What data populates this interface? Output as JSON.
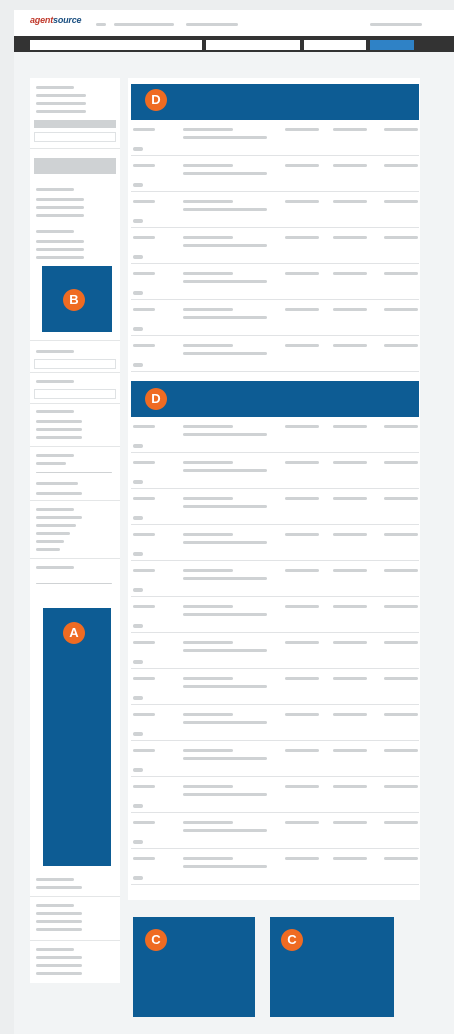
{
  "brand": {
    "name_prefix": "agent",
    "name_suffix": "source"
  },
  "badges": {
    "a": "A",
    "b": "B",
    "c1": "C",
    "c2": "C",
    "d1": "D",
    "d2": "D"
  },
  "colors": {
    "accent": "#0d5c94",
    "badge": "#ef6b22",
    "search_button": "#2f82c6"
  }
}
